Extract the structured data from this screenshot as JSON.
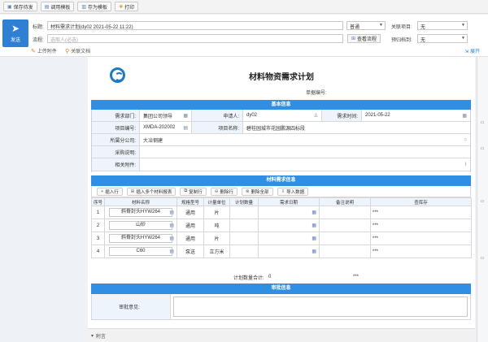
{
  "toolbar": {
    "buttons": [
      {
        "label": "保存待发",
        "icon": "save-icon"
      },
      {
        "label": "调用模板",
        "icon": "template-icon"
      },
      {
        "label": "存为模板",
        "icon": "save-template-icon"
      },
      {
        "label": "打印",
        "icon": "print-icon"
      }
    ]
  },
  "header": {
    "send_label": "发送",
    "title_label": "标题:",
    "title_value": "材料需求计划(dy02 2021-05-22 11:22)",
    "flow_label": "流程:",
    "flow_placeholder": "选取人(必选)",
    "priority_value": "普通",
    "related_label": "关联项目:",
    "related_value": "无",
    "archive_label": "预归档到:",
    "archive_value": "无",
    "view_flow_label": "查看流程",
    "upload_label": "上传附件",
    "related_doc_label": "关联文档",
    "expand_label": "展开"
  },
  "form": {
    "title": "材料物资需求计划",
    "doc_no_label": "单据编号:",
    "basic_section": "基本信息",
    "dept_label": "需求部门:",
    "dept_value": "集团公司领导",
    "applicant_label": "申请人:",
    "applicant_value": "dy02",
    "date_label": "需求时间:",
    "date_value": "2021-05-22",
    "project_no_label": "项目编号:",
    "project_no_value": "XMDA-202002",
    "project_name_label": "项目名称:",
    "project_name_value": "碧桂园城市花园鹏源四标段",
    "branch_label": "所属分公司:",
    "branch_value": "大冶钢建",
    "purchase_note_label": "采购说明:",
    "attachment_label": "相关附件:",
    "material_section": "材料需求信息",
    "actions": [
      {
        "label": "插入行",
        "icon": "plus-icon"
      },
      {
        "label": "插入多个材料报表",
        "icon": "insert-multi-icon"
      },
      {
        "label": "复制行",
        "icon": "copy-icon"
      },
      {
        "label": "删除行",
        "icon": "delete-row-icon"
      },
      {
        "label": "删除全部",
        "icon": "delete-all-icon"
      },
      {
        "label": "导入数据",
        "icon": "import-icon"
      }
    ],
    "columns": [
      "序号",
      "材料名称",
      "规格型号",
      "计量单位",
      "计划数量",
      "需求日期",
      "备注说明",
      "查库存"
    ],
    "rows": [
      {
        "no": "1",
        "name": "斜脊封头HYW264",
        "spec": "通用",
        "unit": "片",
        "qty": "",
        "stock": "***"
      },
      {
        "no": "2",
        "name": "山砂",
        "spec": "通用",
        "unit": "吨",
        "qty": "",
        "stock": "***"
      },
      {
        "no": "3",
        "name": "斜脊封头HYW264",
        "spec": "通用",
        "unit": "片",
        "qty": "",
        "stock": "***"
      },
      {
        "no": "4",
        "name": "C60",
        "spec": "泵送",
        "unit": "立方米",
        "qty": "",
        "stock": "***"
      }
    ],
    "total_label": "计划数量合计:",
    "total_value": "0",
    "total_stock": "***",
    "approval_section": "审批信息",
    "approval_label": "审批意见:"
  },
  "footer": {
    "label": "附言"
  }
}
